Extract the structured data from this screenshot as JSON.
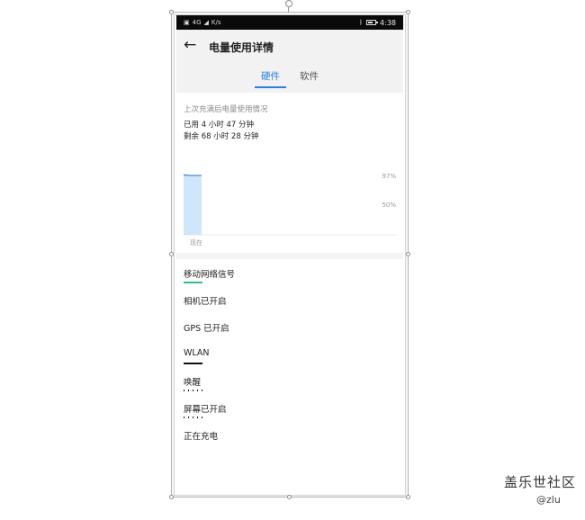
{
  "statusbar": {
    "left_text": "4G",
    "speed": "K/s",
    "time": "4:38",
    "battery_level": 0.7
  },
  "header": {
    "title": "电量使用详情",
    "tabs": [
      {
        "label": "硬件",
        "active": true
      },
      {
        "label": "软件",
        "active": false
      }
    ]
  },
  "summary": {
    "title": "上次充满后电量使用情况",
    "used": "已用 4 小时 47 分钟",
    "remaining": "剩余 68 小时 28 分钟"
  },
  "chart_data": {
    "type": "area",
    "x": [
      0,
      1,
      2,
      3
    ],
    "values": [
      98,
      97,
      97,
      97
    ],
    "y_tick_labels": [
      "97%",
      "50%"
    ],
    "x_tick_labels": [
      "现在"
    ],
    "ylim": [
      0,
      100
    ],
    "fill_color": "#cfe6fb",
    "line_color": "#2d7fe0"
  },
  "hardware": [
    {
      "label": "移动网络信号",
      "bar_color": "#2ec27e",
      "bar_style": "solid",
      "bar_fraction": 0.09
    },
    {
      "label": "相机已开启",
      "bar_color": "",
      "bar_style": "none",
      "bar_fraction": 0
    },
    {
      "label": "GPS 已开启",
      "bar_color": "",
      "bar_style": "none",
      "bar_fraction": 0
    },
    {
      "label": "WLAN",
      "bar_color": "#111111",
      "bar_style": "solid",
      "bar_fraction": 0.09
    },
    {
      "label": "唤醒",
      "bar_color": "#111111",
      "bar_style": "dots",
      "bar_fraction": 0.09
    },
    {
      "label": "屏幕已开启",
      "bar_color": "#111111",
      "bar_style": "dots",
      "bar_fraction": 0.09
    },
    {
      "label": "正在充电",
      "bar_color": "",
      "bar_style": "none",
      "bar_fraction": 0
    }
  ],
  "watermark": {
    "title": "盖乐世社区",
    "user": "@zlu"
  }
}
